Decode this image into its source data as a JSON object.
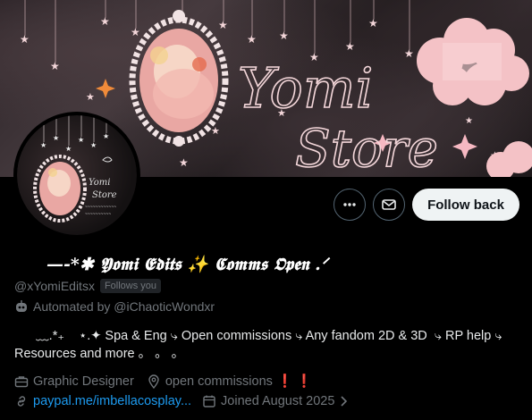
{
  "banner": {
    "logo_line1": "Yomi",
    "logo_line2": "Store"
  },
  "actions": {
    "more_icon": "more-horizontal-icon",
    "message_icon": "envelope-icon",
    "follow_label": "Follow back"
  },
  "profile": {
    "display_name": "—-*✱ 𝖄𝖔𝖒𝖎 𝕰𝖉𝖎𝖙𝖘 ✨ 𝕮𝖔𝖒𝖒𝖘 𝕺𝖕𝖊𝖓 .ᐟ",
    "handle": "@xYomiEditsx",
    "follows_badge": "Follows you",
    "automated_text": "Automated by @iChaoticWondxr",
    "bio": "      ﹏.*₊    ⋆.✦ Spa & Eng ⤷ Open commissions ⤷ Any fandom 2D & 3D  ⤷ RP help ⤷ Resources and more 。 。 。",
    "category": "Graphic Designer",
    "location": "open commissions",
    "location_suffix": "❗❗",
    "link": "paypal.me/imbellacosplay...",
    "joined": "Joined August 2025"
  },
  "colors": {
    "accent_link": "#1d9bf0",
    "muted": "#71767b",
    "banner_pink": "#f4c2c6"
  }
}
